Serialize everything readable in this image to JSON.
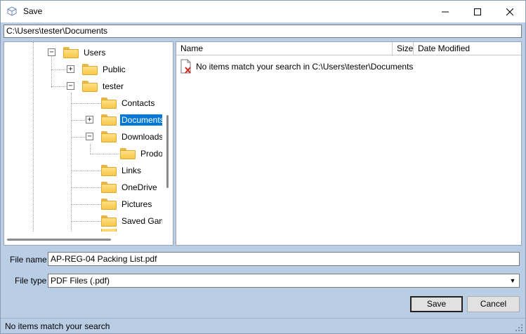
{
  "window": {
    "title": "Save",
    "minimize_icon": "minimize-icon",
    "maximize_icon": "maximize-icon",
    "close_icon": "close-icon"
  },
  "path": "C:\\Users\\tester\\Documents",
  "tree": {
    "nodes": [
      {
        "label": "Users",
        "expander": "−"
      },
      {
        "label": "Public",
        "expander": "+"
      },
      {
        "label": "tester",
        "expander": "−"
      },
      {
        "label": "Contacts"
      },
      {
        "label": "Documents",
        "expander": "+",
        "selected": true
      },
      {
        "label": "Downloads",
        "expander": "−"
      },
      {
        "label": "Prodo"
      },
      {
        "label": "Links"
      },
      {
        "label": "OneDrive"
      },
      {
        "label": "Pictures"
      },
      {
        "label": "Saved Gam"
      }
    ]
  },
  "list": {
    "columns": {
      "name": "Name",
      "size": "Size",
      "date": "Date Modified"
    },
    "empty_message": "No items match your search in C:\\Users\\tester\\Documents"
  },
  "form": {
    "file_name_label": "File name",
    "file_name_value": "AP-REG-04 Packing List.pdf",
    "file_type_label": "File type",
    "file_type_value": "PDF Files (.pdf)"
  },
  "buttons": {
    "save": "Save",
    "cancel": "Cancel"
  },
  "status": "No items match your search",
  "colors": {
    "accent": "#0078d7",
    "chrome": "#b9cde5"
  }
}
